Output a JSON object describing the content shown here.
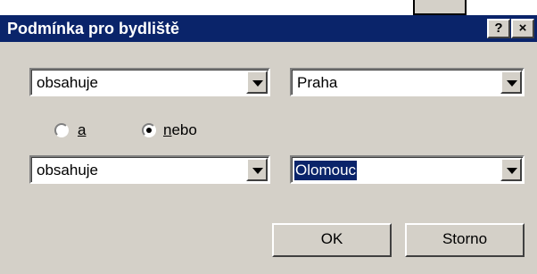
{
  "dialog": {
    "title": "Podmínka pro bydliště",
    "help_label": "?",
    "close_label": "×"
  },
  "row1": {
    "operator": "obsahuje",
    "value": "Praha"
  },
  "logic": {
    "and_label": "a",
    "or_label": "nebo",
    "selected": "nebo"
  },
  "row2": {
    "operator": "obsahuje",
    "value": "Olomouc"
  },
  "buttons": {
    "ok_label": "OK",
    "cancel_label": "Storno"
  },
  "colors": {
    "titlebar": "#0a246a",
    "face": "#d4d0c8"
  }
}
